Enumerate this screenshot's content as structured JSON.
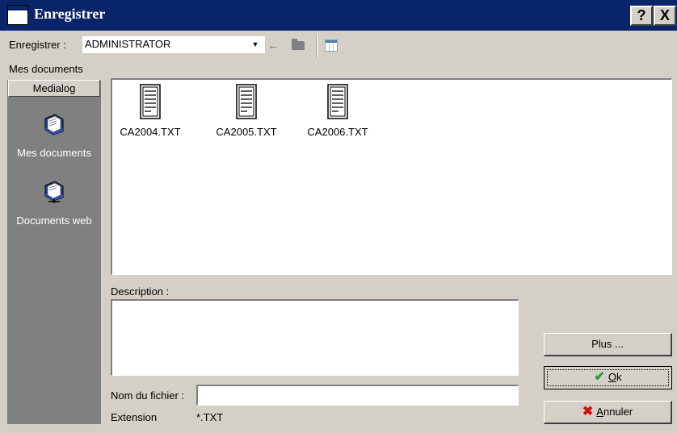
{
  "window": {
    "title": "Enregistrer",
    "help_button": "?",
    "close_button": "X"
  },
  "toolbar": {
    "save_in_label": "Enregistrer :",
    "location_value": "ADMINISTRATOR"
  },
  "breadcrumb": "Mes documents",
  "sidebar": {
    "header": "Medialog",
    "items": [
      {
        "label": "Mes documents",
        "icon": "folder-document-icon"
      },
      {
        "label": "Documents web",
        "icon": "web-folder-icon"
      }
    ]
  },
  "files": [
    {
      "name": "CA2004.TXT",
      "icon": "text-file-icon"
    },
    {
      "name": "CA2005.TXT",
      "icon": "text-file-icon"
    },
    {
      "name": "CA2006.TXT",
      "icon": "text-file-icon"
    }
  ],
  "form": {
    "description_label": "Description :",
    "description_value": "",
    "filename_label": "Nom du fichier :",
    "filename_value": "",
    "extension_label": "Extension",
    "extension_value": "*.TXT"
  },
  "buttons": {
    "more": "Plus ...",
    "ok_accel": "O",
    "ok_rest": "k",
    "cancel_accel": "A",
    "cancel_rest": "nnuler"
  },
  "colors": {
    "titlebar": "#0a246a",
    "face": "#d4d0c8",
    "sidebar": "#808080"
  }
}
